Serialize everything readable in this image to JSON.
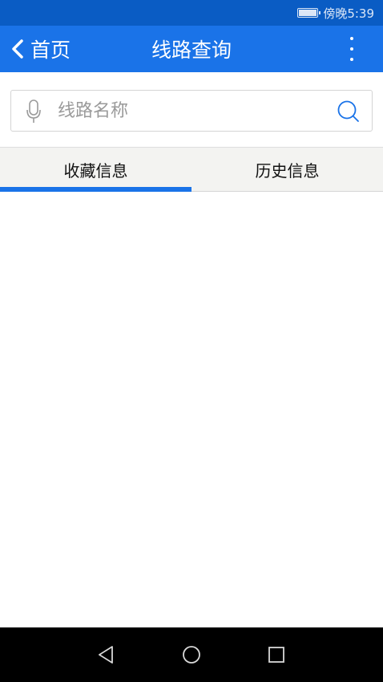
{
  "status_bar": {
    "time": "傍晚5:39",
    "battery_icon": "battery-full-icon"
  },
  "app_bar": {
    "back_label": "首页",
    "title": "线路查询",
    "back_icon": "chevron-left-icon",
    "more_icon": "more-vertical-icon",
    "color": "#1a73e8"
  },
  "search": {
    "placeholder": "线路名称",
    "value": "",
    "mic_icon": "microphone-icon",
    "search_icon": "search-icon"
  },
  "tabs": [
    {
      "label": "收藏信息",
      "active": true
    },
    {
      "label": "历史信息",
      "active": false
    }
  ],
  "nav_bar": {
    "back_icon": "nav-back-icon",
    "home_icon": "nav-home-icon",
    "recents_icon": "nav-recents-icon"
  }
}
